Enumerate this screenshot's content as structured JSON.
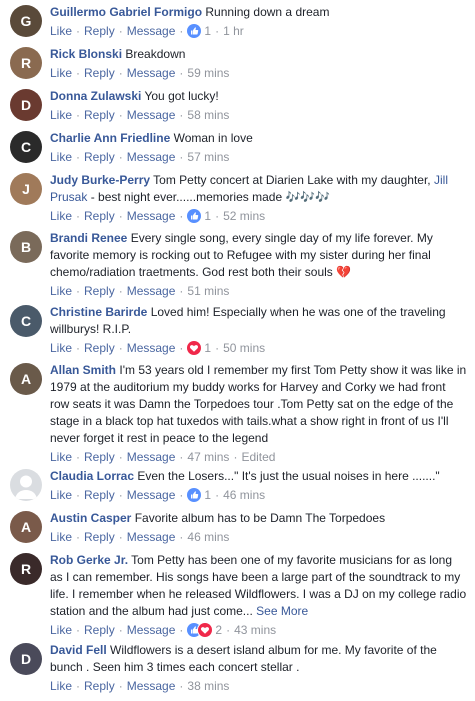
{
  "actions": {
    "like": "Like",
    "reply": "Reply",
    "message": "Message",
    "separator": "·"
  },
  "comments": [
    {
      "author": "Guillermo Gabriel Formigo",
      "text": "Running down a dream",
      "reaction": "like",
      "reaction_count": "1",
      "time": "1 hr",
      "avatar_color": "#5a4a3a",
      "avatar_letter": "G"
    },
    {
      "author": "Rick Blonski",
      "text": "Breakdown",
      "time": "59 mins",
      "avatar_color": "#8a6a50",
      "avatar_letter": "R"
    },
    {
      "author": "Donna Zulawski",
      "text": "You got lucky!",
      "time": "58 mins",
      "avatar_color": "#6a3a30",
      "avatar_letter": "D"
    },
    {
      "author": "Charlie Ann Friedline",
      "text": "Woman in love",
      "time": "57 mins",
      "avatar_color": "#2a2a2a",
      "avatar_letter": "C"
    },
    {
      "author": "Judy Burke-Perry",
      "text_pre": "Tom Petty concert at Diarien Lake with my daughter,",
      "mention": "Jill Prusak",
      "text_post": "- best night ever......memories made",
      "emoji": "🎶🎶🎶",
      "reaction": "like",
      "reaction_count": "1",
      "time": "52 mins",
      "avatar_color": "#a07a5a",
      "avatar_letter": "J"
    },
    {
      "author": "Brandi Renee",
      "text": "Every single song, every single day of my life forever. My favorite memory is rocking out to Refugee with my sister during her final chemo/radiation traetments. God rest both their souls",
      "emoji_heart": "💔",
      "time": "51 mins",
      "avatar_color": "#7a6a5a",
      "avatar_letter": "B"
    },
    {
      "author": "Christine Barirde",
      "text": "Loved him! Especially when he was one of the traveling willburys! R.I.P.",
      "reaction": "love",
      "reaction_count": "1",
      "time": "50 mins",
      "avatar_color": "#4a5a6a",
      "avatar_letter": "C"
    },
    {
      "author": "Allan Smith",
      "text": "I'm 53 years old I remember my first Tom Petty show it was like in 1979 at the auditorium my buddy works for Harvey and Corky we had front row seats it was Damn the Torpedoes tour .Tom Petty sat on the edge of the stage in a black top hat tuxedos with tails.what a show right in front of us I'll never forget it rest in peace to the legend",
      "time": "47 mins",
      "edited": "Edited",
      "avatar_color": "#6a5a4a",
      "avatar_letter": "A"
    },
    {
      "author": "Claudia Lorrac",
      "text": "Even the Losers...\" It's just the usual noises in here .......\"",
      "reaction": "like",
      "reaction_count": "1",
      "time": "46 mins",
      "avatar_placeholder": true
    },
    {
      "author": "Austin Casper",
      "text": "Favorite album has to be Damn The Torpedoes",
      "time": "46 mins",
      "avatar_color": "#7a5a4a",
      "avatar_letter": "A"
    },
    {
      "author": "Rob Gerke Jr.",
      "text": "Tom Petty has been one of my favorite musicians for as long as I can remember. His songs have been a large part of the soundtrack to my life. I remember when he released Wildflowers. I was a DJ on my college radio station and the album had just come...",
      "see_more": "See More",
      "reaction": "like-love",
      "reaction_count": "2",
      "time": "43 mins",
      "avatar_color": "#3a2a2a",
      "avatar_letter": "R"
    },
    {
      "author": "David Fell",
      "text": "Wildflowers is a desert island album for me. My favorite of the bunch . Seen him 3 times each concert stellar .",
      "time": "38 mins",
      "avatar_color": "#4a4a5a",
      "avatar_letter": "D"
    }
  ],
  "colors": {
    "link": "#385898",
    "action_link": "#4b67a1",
    "meta": "#90949c",
    "like_blue": "#5890ff",
    "love_red": "#f0284a"
  }
}
